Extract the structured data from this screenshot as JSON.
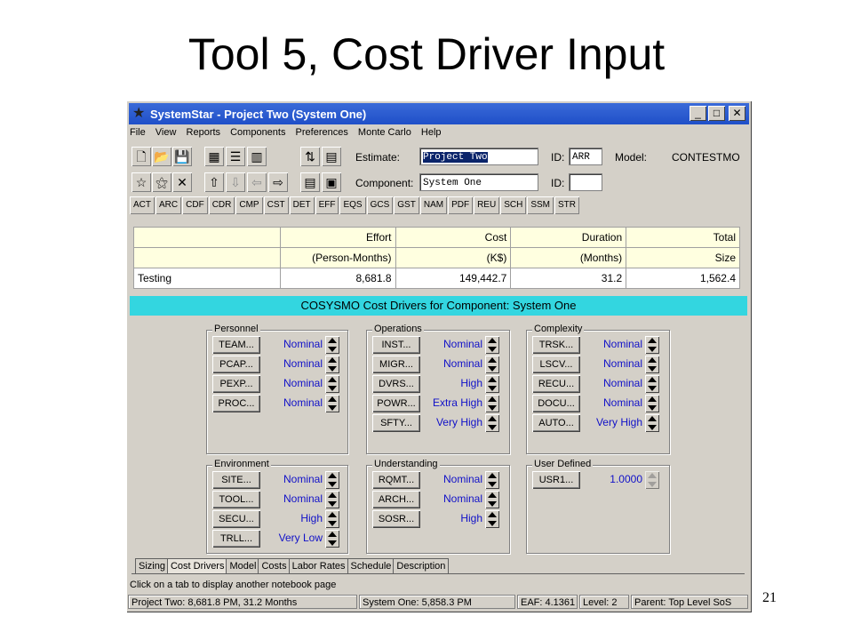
{
  "slide": {
    "title": "Tool 5, Cost Driver Input",
    "page_number": "21"
  },
  "window": {
    "title": "SystemStar - Project Two (System One)",
    "buttons": {
      "minimize": "_",
      "maximize": "□",
      "close": "✕"
    }
  },
  "menu": [
    "File",
    "View",
    "Reports",
    "Components",
    "Preferences",
    "Monte Carlo",
    "Help"
  ],
  "toolbar": {
    "estimate_label": "Estimate:",
    "estimate_value": "Project Two",
    "id_label": "ID:",
    "estimate_id": "ARR",
    "model_label": "Model:",
    "model_value": "CONTESTMO",
    "component_label": "Component:",
    "component_value": "System One",
    "component_id_label": "ID:",
    "component_id": ""
  },
  "tool_buttons": [
    "ACT",
    "ARC",
    "CDF",
    "CDR",
    "CMP",
    "CST",
    "DET",
    "EFF",
    "EQS",
    "GCS",
    "GST",
    "NAM",
    "PDF",
    "REU",
    "SCH",
    "SSM",
    "STR"
  ],
  "results": {
    "headers_top": [
      "",
      "Effort",
      "Cost",
      "Duration",
      "Total"
    ],
    "headers_bottom": [
      "",
      "(Person-Months)",
      "(K$)",
      "(Months)",
      "Size"
    ],
    "row": [
      "Testing",
      "8,681.8",
      "149,442.7",
      "31.2",
      "1,562.4"
    ]
  },
  "banner": "COSYSMO Cost Drivers for Component: System One",
  "groups": {
    "personnel": {
      "title": "Personnel",
      "drivers": [
        {
          "button": "TEAM...",
          "value": "Nominal"
        },
        {
          "button": "PCAP...",
          "value": "Nominal"
        },
        {
          "button": "PEXP...",
          "value": "Nominal"
        },
        {
          "button": "PROC...",
          "value": "Nominal"
        }
      ]
    },
    "operations": {
      "title": "Operations",
      "drivers": [
        {
          "button": "INST...",
          "value": "Nominal"
        },
        {
          "button": "MIGR...",
          "value": "Nominal"
        },
        {
          "button": "DVRS...",
          "value": "High"
        },
        {
          "button": "POWR...",
          "value": "Extra High"
        },
        {
          "button": "SFTY...",
          "value": "Very High"
        }
      ]
    },
    "complexity": {
      "title": "Complexity",
      "drivers": [
        {
          "button": "TRSK...",
          "value": "Nominal"
        },
        {
          "button": "LSCV...",
          "value": "Nominal"
        },
        {
          "button": "RECU...",
          "value": "Nominal"
        },
        {
          "button": "DOCU...",
          "value": "Nominal"
        },
        {
          "button": "AUTO...",
          "value": "Very High"
        }
      ]
    },
    "environment": {
      "title": "Environment",
      "drivers": [
        {
          "button": "SITE...",
          "value": "Nominal"
        },
        {
          "button": "TOOL...",
          "value": "Nominal"
        },
        {
          "button": "SECU...",
          "value": "High"
        },
        {
          "button": "TRLL...",
          "value": "Very Low"
        }
      ]
    },
    "understanding": {
      "title": "Understanding",
      "drivers": [
        {
          "button": "RQMT...",
          "value": "Nominal"
        },
        {
          "button": "ARCH...",
          "value": "Nominal"
        },
        {
          "button": "SOSR...",
          "value": "High"
        }
      ]
    },
    "user_defined": {
      "title": "User Defined",
      "drivers": [
        {
          "button": "USR1...",
          "value": "1.0000"
        }
      ]
    }
  },
  "tabs": [
    "Sizing",
    "Cost Drivers",
    "Model",
    "Costs",
    "Labor Rates",
    "Schedule",
    "Description"
  ],
  "active_tab": "Cost Drivers",
  "status_message": "Click on a tab to display another notebook page",
  "statusbar": {
    "project": "Project Two:  8,681.8 PM,  31.2 Months",
    "system": "System One:  5,858.3 PM",
    "eaf": "EAF: 4.1361",
    "level": "Level:  2",
    "parent": "Parent: Top Level SoS"
  },
  "colors": {
    "title_bar": "#1f4fc8",
    "banner": "#33d6e0",
    "value_text": "#1010c8"
  }
}
